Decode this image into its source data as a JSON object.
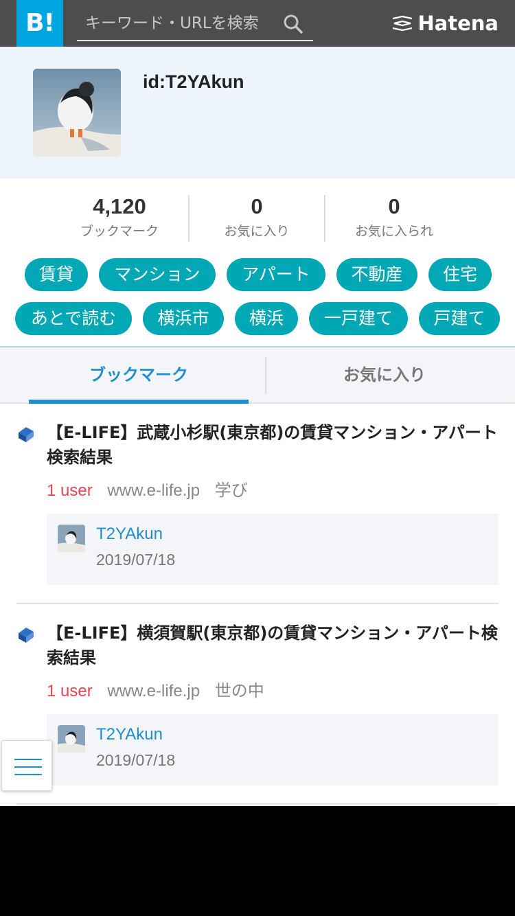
{
  "header": {
    "logo_text": "B!",
    "search_placeholder": "キーワード・URLを検索",
    "brand": "Hatena"
  },
  "profile": {
    "user_id": "id:T2YAkun"
  },
  "stats": [
    {
      "value": "4,120",
      "label": "ブックマーク"
    },
    {
      "value": "0",
      "label": "お気に入り"
    },
    {
      "value": "0",
      "label": "お気に入られ"
    }
  ],
  "tags": [
    "賃貸",
    "マンション",
    "アパート",
    "不動産",
    "住宅",
    "あとで読む",
    "横浜市",
    "横浜",
    "一戸建て",
    "戸建て"
  ],
  "tabs": {
    "active": "ブックマーク",
    "other": "お気に入り"
  },
  "entries": [
    {
      "title": "【E-LIFE】武蔵小杉駅(東京都)の賃貸マンション・アパート検索結果",
      "users": "1 user",
      "domain": "www.e-life.jp",
      "category": "学び",
      "comment_user": "T2YAkun",
      "comment_date": "2019/07/18"
    },
    {
      "title": "【E-LIFE】横須賀駅(東京都)の賃貸マンション・アパート検索結果",
      "users": "1 user",
      "domain": "www.e-life.jp",
      "category": "世の中",
      "comment_user": "T2YAkun",
      "comment_date": "2019/07/18"
    }
  ],
  "icons": [
    "search-icon",
    "hatena-brand-icon",
    "favicon-icon",
    "menu-icon"
  ],
  "colors": {
    "header_bg": "#4d4d4d",
    "logo_bg": "#00a4de",
    "tag_bg": "#00a7b4",
    "accent": "#1f8fd0",
    "user_count": "#e64550"
  }
}
